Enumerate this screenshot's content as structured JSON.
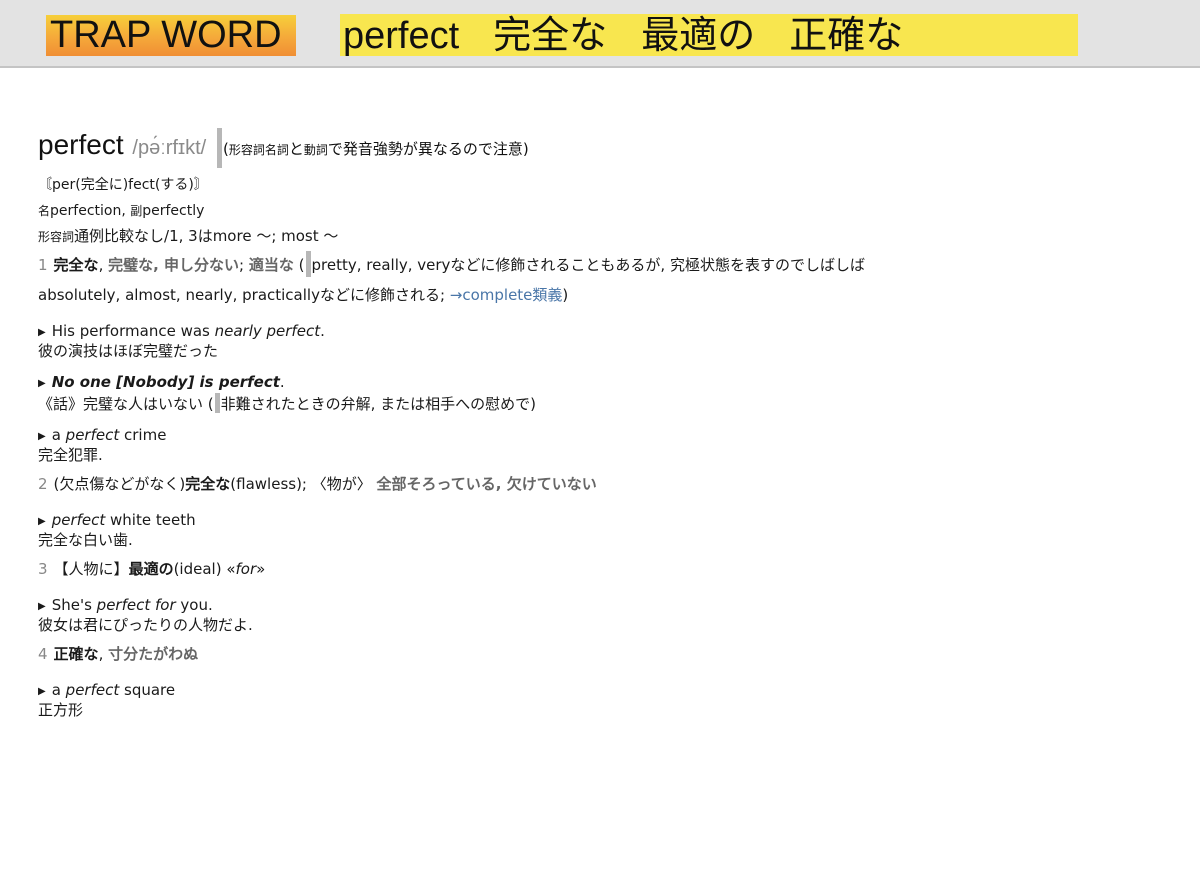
{
  "banner": {
    "tag": "TRAP WORD",
    "terms": [
      "perfect",
      "完全な",
      "最適の",
      "正確な"
    ]
  },
  "entry": {
    "headword": "perfect",
    "pronunciation": "/pə́ːrfɪkt/",
    "pos_note": {
      "open": "(",
      "pos1": "形容詞名詞",
      "mid": "と",
      "pos2": "動詞",
      "rest": "で発音強勢が異なるので注意)"
    },
    "etymology": "〘per(完全に)fect(する)〙",
    "derived": {
      "noun_tag": "名",
      "noun": "perfection,",
      "adv_tag": "副",
      "adv": "perfectly"
    },
    "grammar": {
      "tag": "形容詞",
      "text": "通例比較なし/1, 3はmore 〜; most 〜"
    },
    "senses": [
      {
        "num": "1",
        "head_bold": "完全な",
        "head_rest_a": ", ",
        "head_gray": "完璧な, 申し分ない",
        "head_sep": "; ",
        "head_gray2": "適当な",
        "note_open": " (",
        "note_text": "pretty, really, veryなどに修飾されることもあるが, 究極状態を表すのでしばしば",
        "note_line2": "absolutely, almost, nearly, practicallyなどに修飾される; ",
        "link": "→complete類義",
        "note_close": ")"
      }
    ],
    "examples_1": [
      {
        "pre": "His performance was ",
        "italic": "nearly perfect",
        "post": ".",
        "translation": "彼の演技はほぼ完璧だった"
      },
      {
        "bold_italic": "No one ",
        "bracket": "[Nobody]",
        "bold_italic2": " is perfect",
        "post": ".",
        "translation_pre": "《話》完璧な人はいない (",
        "translation_post": "非難されたときの弁解, または相手への慰めで)"
      },
      {
        "pre": "a ",
        "italic": "perfect",
        "post": " crime",
        "translation": "完全犯罪."
      }
    ],
    "sense2": {
      "num": "2",
      "pre": "(欠点傷などがなく)",
      "bold": "完全な",
      "mid": "(flawless); 〈物が〉",
      "gray": "全部そろっている, 欠けていない"
    },
    "example_2": {
      "italic": "perfect",
      "post": " white teeth",
      "translation": "完全な白い歯."
    },
    "sense3": {
      "num": "3",
      "pre": "【人物に】",
      "bold": "最適の",
      "mid": "(ideal) «",
      "italic": "for",
      "post": "»"
    },
    "example_3": {
      "pre": "She's ",
      "italic": "perfect for",
      "post": " you.",
      "translation": "彼女は君にぴったりの人物だよ."
    },
    "sense4": {
      "num": "4",
      "bold": "正確な",
      "sep": ", ",
      "gray": "寸分たがわぬ"
    },
    "example_4": {
      "pre": "a ",
      "italic": "perfect",
      "post": " square",
      "translation": "正方形"
    }
  }
}
